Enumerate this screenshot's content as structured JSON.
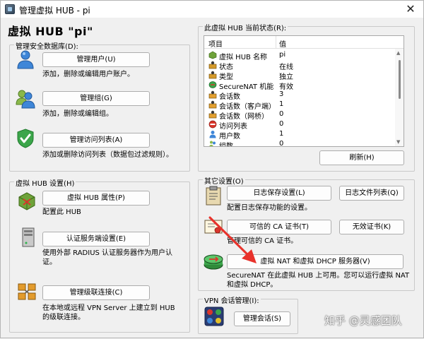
{
  "window": {
    "title": "管理虚拟 HUB - pi",
    "close_glyph": "✕"
  },
  "hub_title": "虚拟 HUB \"pi\"",
  "security_db": {
    "label": "管理安全数据库(D):",
    "users_button": "管理用户(U)",
    "users_desc": "添加，删除或编辑用户账户。",
    "groups_button": "管理组(G)",
    "groups_desc": "添加，删除或编辑组。",
    "acl_button": "管理访问列表(A)",
    "acl_desc": "添加或删除访问列表（数据包过滤规则）。"
  },
  "hub_settings": {
    "label": "虚拟 HUB 设置(H)",
    "props_button": "虚拟 HUB 属性(P)",
    "props_desc": "配置此 HUB",
    "auth_button": "认证服务端设置(E)",
    "auth_desc_1": "使用外部 RADIUS 认证服务器作为用户认",
    "auth_desc_2": "证。",
    "cascade_button": "管理级联连接(C)",
    "cascade_desc_1": "在本地或远程 VPN Server 上建立到 HUB",
    "cascade_desc_2": "的级联连接。"
  },
  "status": {
    "label": "此虚拟 HUB 当前状态(R):",
    "col_item": "项目",
    "col_value": "值",
    "rows": [
      {
        "key": "虚拟 HUB 名称",
        "value": "pi",
        "icon": "hub-icon"
      },
      {
        "key": "状态",
        "value": "在线",
        "icon": "status-icon"
      },
      {
        "key": "类型",
        "value": "独立",
        "icon": "type-icon"
      },
      {
        "key": "SecureNAT 机能",
        "value": "有效",
        "icon": "securenat-icon"
      },
      {
        "key": "会话数",
        "value": "3",
        "icon": "session-icon"
      },
      {
        "key": "会话数（客户端）",
        "value": "1",
        "icon": "session-client-icon"
      },
      {
        "key": "会话数（网桥）",
        "value": "0",
        "icon": "session-bridge-icon"
      },
      {
        "key": "访问列表",
        "value": "0",
        "icon": "acl-icon"
      },
      {
        "key": "用户数",
        "value": "1",
        "icon": "users-icon"
      },
      {
        "key": "组数",
        "value": "0",
        "icon": "groups-icon"
      }
    ],
    "refresh_button": "刷新(H)"
  },
  "other": {
    "label": "其它设置(O)",
    "log_button": "日志保存设置(L)",
    "logfiles_button": "日志文件列表(Q)",
    "log_desc": "配置日志保存功能的设置。",
    "ca_button": "可信的 CA 证书(T)",
    "crl_button": "无效证书(K)",
    "ca_desc": "管理可信的 CA 证书。",
    "nat_button": "虚拟 NAT 和虚拟 DHCP 服务器(V)",
    "nat_desc_1": "SecureNAT 在此虚拟 HUB 上可用。您可以运行虚拟 NAT",
    "nat_desc_2": "和虚拟 DHCP。"
  },
  "vpn_sessions": {
    "label": "VPN 会话管理(I):",
    "button": "管理会话(S)"
  },
  "watermark": "知乎 @灵感团队",
  "colors": {
    "annotation_arrow": "#e8322b",
    "button_border": "#adadad",
    "window_bg": "#f0f0f0"
  }
}
